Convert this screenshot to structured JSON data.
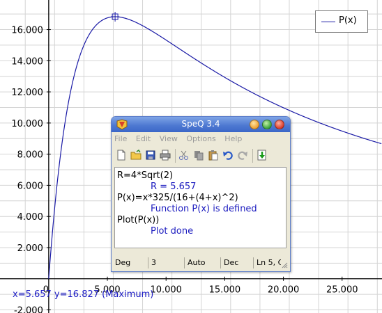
{
  "plot": {
    "x_ticks": [
      {
        "value": 0,
        "label": "0"
      },
      {
        "value": 5,
        "label": "5.000"
      },
      {
        "value": 10,
        "label": "10.000"
      },
      {
        "value": 15,
        "label": "15.000"
      },
      {
        "value": 20,
        "label": "20.000"
      },
      {
        "value": 25,
        "label": "25.000"
      }
    ],
    "y_ticks": [
      {
        "value": 2,
        "label": "2.000"
      },
      {
        "value": 4,
        "label": "4.000"
      },
      {
        "value": 6,
        "label": "6.000"
      },
      {
        "value": 8,
        "label": "8.000"
      },
      {
        "value": 10,
        "label": "10.000"
      },
      {
        "value": 12,
        "label": "12.000"
      },
      {
        "value": 14,
        "label": "14.000"
      },
      {
        "value": 16,
        "label": "16.000"
      },
      {
        "value": -2,
        "label": "-2.000"
      }
    ],
    "x_range": [
      -4.15,
      28.4
    ],
    "y_range": [
      -2.2,
      17.9
    ],
    "curve_color": "#1a1aa6",
    "grid_color": "#d4d4d4",
    "marker": {
      "x": 5.657,
      "y": 16.827
    },
    "legend": "P(x)",
    "status": "x=5.657 y=16.827 (Maximum)"
  },
  "chart_data": {
    "type": "line",
    "title": "",
    "xlabel": "",
    "ylabel": "",
    "xlim": [
      -4.15,
      28.4
    ],
    "ylim": [
      -2.2,
      17.9
    ],
    "grid": true,
    "legend_position": "top-right",
    "series": [
      {
        "name": "P(x)",
        "function": "x*325/(16+(4+x)^2)",
        "x": [
          0,
          1,
          2,
          3,
          4,
          5.657,
          7,
          10,
          15,
          20,
          25,
          28.4
        ],
        "y": [
          0,
          7.93,
          12.5,
          15.0,
          16.25,
          16.83,
          16.52,
          15.29,
          12.87,
          10.97,
          9.51,
          8.58
        ]
      }
    ],
    "annotation": "x=5.657 y=16.827 (Maximum)"
  },
  "window": {
    "title": "SpeQ 3.4",
    "menu": [
      "File",
      "Edit",
      "View",
      "Options",
      "Help"
    ],
    "toolbar_icons": [
      "new-file-icon",
      "open-folder-icon",
      "save-icon",
      "print-icon",
      "cut-icon",
      "copy-icon",
      "paste-icon",
      "undo-icon",
      "redo-icon",
      "insert-icon"
    ],
    "editor_lines": [
      {
        "type": "input",
        "text": "R=4*Sqrt(2)"
      },
      {
        "type": "output",
        "text": "R = 5.657"
      },
      {
        "type": "input",
        "text": "P(x)=x*325/(16+(4+x)^2)"
      },
      {
        "type": "output",
        "text": "Function P(x) is defined"
      },
      {
        "type": "input",
        "text": "Plot(P(x))"
      },
      {
        "type": "output",
        "text": "Plot done"
      }
    ],
    "status": {
      "angle_mode": "Deg",
      "precision": "3",
      "format": "Auto",
      "base": "Dec",
      "position": "Ln 5, C"
    }
  }
}
